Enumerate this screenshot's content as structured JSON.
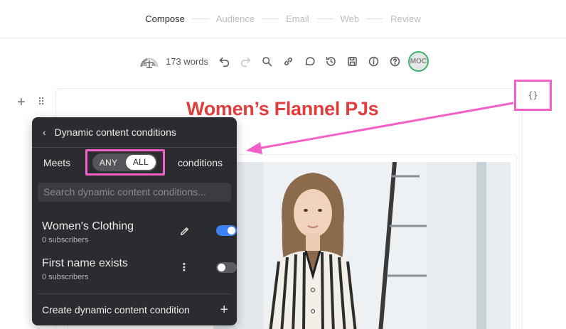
{
  "steps": [
    "Compose",
    "Audience",
    "Email",
    "Web",
    "Review"
  ],
  "active_step": "Compose",
  "toolbar": {
    "word_count": "173 words",
    "avatar_initials": "MOC"
  },
  "editor": {
    "heading": "Women’s Flannel PJs",
    "code_toggle": "{}"
  },
  "panel": {
    "title": "Dynamic content conditions",
    "meets_label": "Meets",
    "match_options": [
      "ANY",
      "ALL"
    ],
    "match_selected": "ALL",
    "conditions_label": "conditions",
    "search_placeholder": "Search dynamic content conditions...",
    "conditions": [
      {
        "name": "Women's Clothing",
        "subscribers": "0 subscribers",
        "enabled": true,
        "action_icon": "pencil-icon"
      },
      {
        "name": "First name exists",
        "subscribers": "0 subscribers",
        "enabled": false,
        "action_icon": "more-vertical-icon"
      }
    ],
    "create_label": "Create dynamic content condition"
  },
  "colors": {
    "heading": "#e03e3e",
    "highlight": "#f35fc7",
    "panel_bg": "#2b2c30",
    "toggle_on": "#3b82f6",
    "avatar_ring": "#3cb371"
  }
}
